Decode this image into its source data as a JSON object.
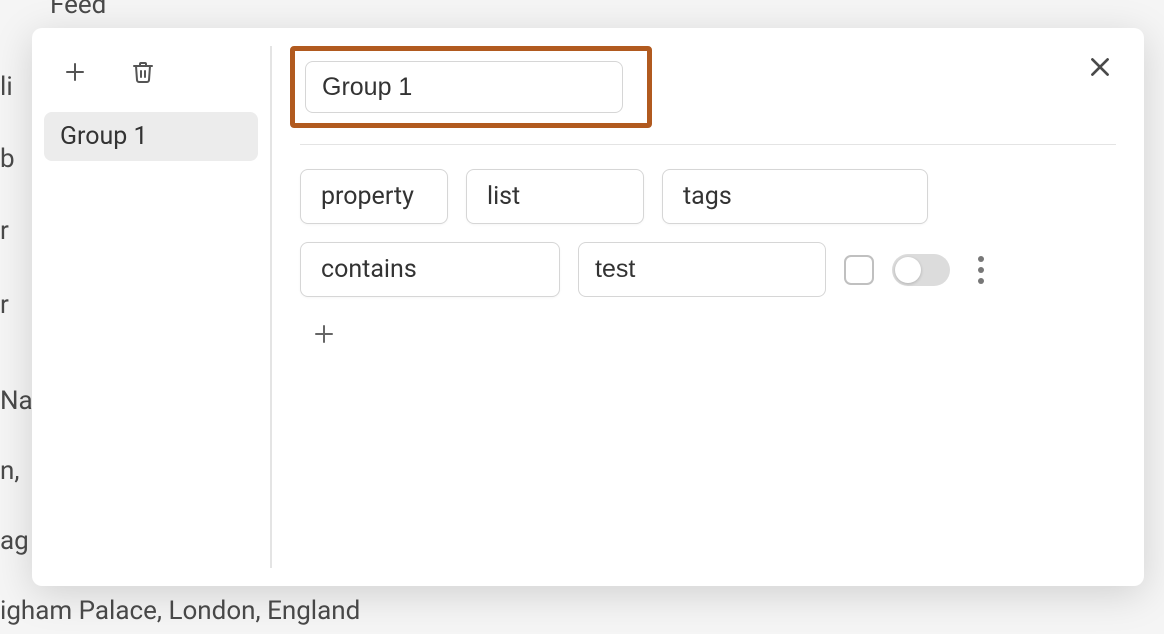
{
  "background": {
    "feed": "Feed",
    "fragments": [
      "li",
      "b",
      "r",
      "r ",
      "Na",
      "n,",
      "ag"
    ],
    "palace": "igham Palace, London, England"
  },
  "sidebar": {
    "groups": [
      {
        "label": "Group 1",
        "active": true
      }
    ]
  },
  "editor": {
    "group_name": "Group 1",
    "filter": {
      "kind": "property",
      "scope": "list",
      "field": "tags",
      "operator": "contains",
      "value": "test",
      "checkbox": false,
      "toggle": false
    }
  }
}
